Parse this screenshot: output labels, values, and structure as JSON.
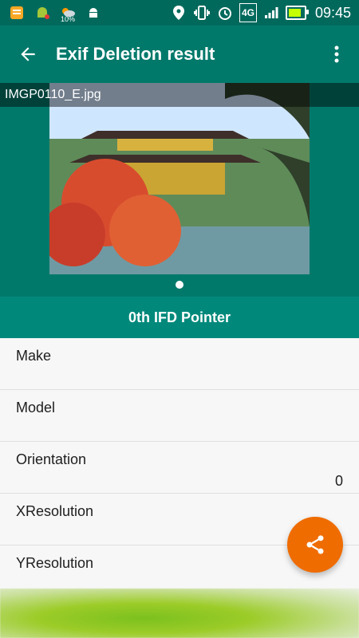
{
  "status_bar": {
    "time": "09:45",
    "network": "4G",
    "weather_percent": "10%"
  },
  "app_bar": {
    "title": "Exif Deletion result",
    "back_icon": "arrow-left-icon",
    "more_icon": "more-vert-icon"
  },
  "image": {
    "filename": "IMGP0110_E.jpg",
    "page_index": 1,
    "page_count": 1
  },
  "section": {
    "title": "0th IFD Pointer"
  },
  "rows": [
    {
      "label": "Make",
      "value": ""
    },
    {
      "label": "Model",
      "value": ""
    },
    {
      "label": "Orientation",
      "value": "0"
    },
    {
      "label": "XResolution",
      "value": ""
    },
    {
      "label": "YResolution",
      "value": ""
    }
  ],
  "fab": {
    "icon": "share-icon",
    "color": "#ef6c00"
  },
  "colors": {
    "primary": "#00796b",
    "primary_dark": "#00695c",
    "accent": "#ef6c00"
  }
}
